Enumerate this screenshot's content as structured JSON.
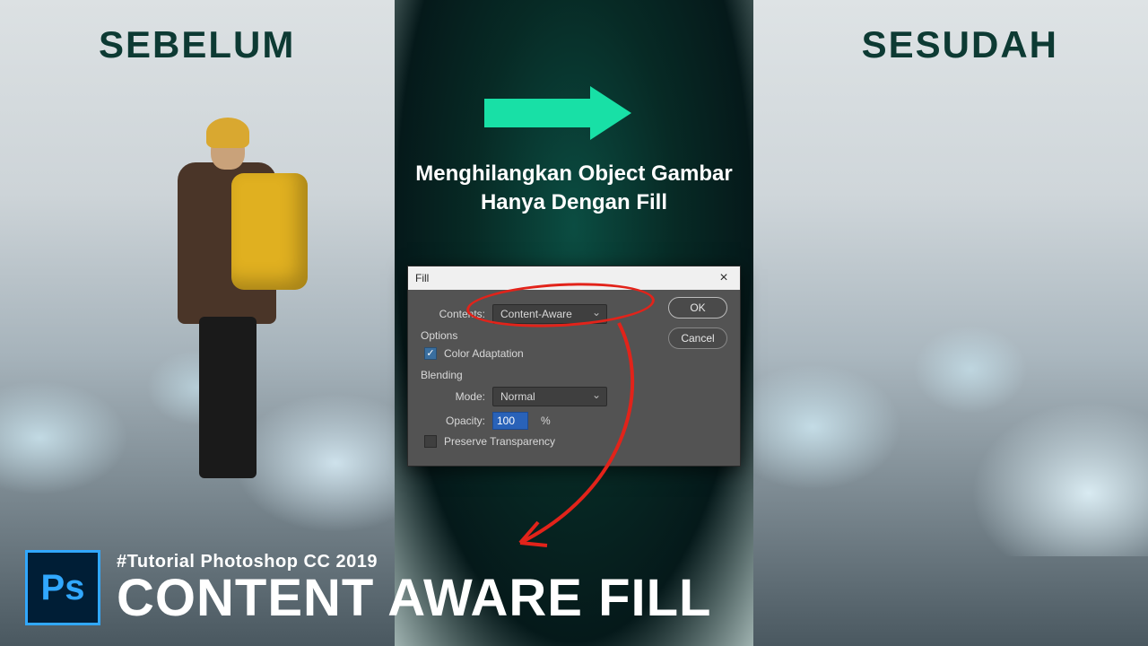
{
  "labels": {
    "before": "SEBELUM",
    "after": "SESUDAH"
  },
  "center": {
    "description": "Menghilangkan Object Gambar Hanya Dengan Fill"
  },
  "dialog": {
    "title": "Fill",
    "contents_label": "Contents:",
    "contents_value": "Content-Aware",
    "options_label": "Options",
    "color_adaptation_label": "Color Adaptation",
    "color_adaptation_checked": true,
    "blending_label": "Blending",
    "mode_label": "Mode:",
    "mode_value": "Normal",
    "opacity_label": "Opacity:",
    "opacity_value": "100",
    "opacity_unit": "%",
    "preserve_label": "Preserve Transparency",
    "preserve_checked": false,
    "ok": "OK",
    "cancel": "Cancel"
  },
  "bottom": {
    "ps": "Ps",
    "hashtag": "#Tutorial Photoshop CC 2019",
    "title": "CONTENT AWARE FILL"
  },
  "colors": {
    "accent_arrow": "#18e0a6",
    "annotation": "#e2231a",
    "ps_bg": "#001e36",
    "ps_fg": "#31a8ff"
  }
}
